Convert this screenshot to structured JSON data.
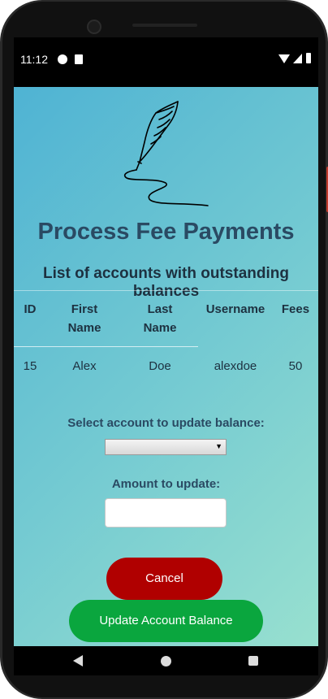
{
  "status_bar": {
    "time": "11:12"
  },
  "page": {
    "title": "Process Fee Payments",
    "subtitle": "List of accounts with outstanding balances"
  },
  "table": {
    "headers": {
      "id": "ID",
      "first_name_l1": "First",
      "first_name_l2": "Name",
      "last_name_l1": "Last",
      "last_name_l2": "Name",
      "username": "Username",
      "fees": "Fees"
    },
    "rows": [
      {
        "id": "15",
        "first_name": "Alex",
        "last_name": "Doe",
        "username": "alexdoe",
        "fees": "50"
      }
    ]
  },
  "form": {
    "select_label": "Select account to update balance:",
    "select_value": "",
    "amount_label": "Amount to update:",
    "amount_value": ""
  },
  "buttons": {
    "cancel": "Cancel",
    "update": "Update Account Balance"
  },
  "colors": {
    "title": "#2a4a63",
    "cancel_button": "#b00000",
    "update_button": "#0aa63e"
  },
  "icons": {
    "logo": "quill-pen-icon",
    "nav_back": "back-triangle-icon",
    "nav_home": "home-circle-icon",
    "nav_recents": "recents-square-icon"
  }
}
